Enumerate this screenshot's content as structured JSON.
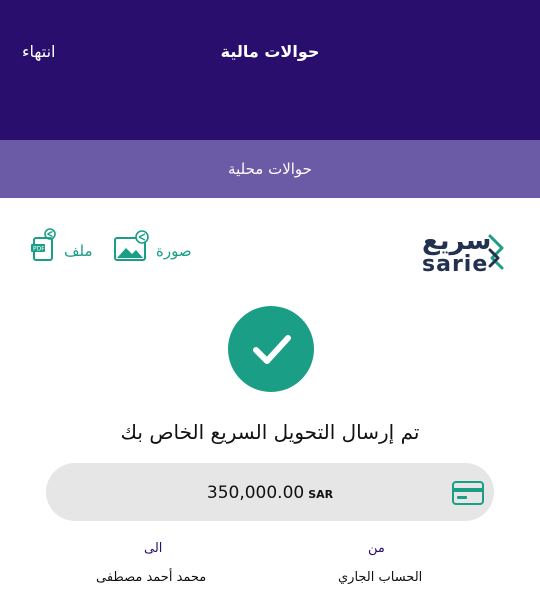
{
  "header": {
    "title": "حوالات مالية",
    "done_label": "انتهاء"
  },
  "subheader": {
    "title": "حوالات محلية"
  },
  "share": {
    "file_label": "ملف",
    "image_label": "صورة",
    "file_icon": "pdf-share-icon",
    "image_icon": "image-share-icon"
  },
  "brand": {
    "name_ar": "سريع",
    "name_en": "sarie",
    "color": "#22314f"
  },
  "status": {
    "icon": "check-icon",
    "message": "تم إرسال التحويل السريع الخاص بك"
  },
  "transfer": {
    "amount": "350,000.00",
    "currency": "SAR",
    "account_icon": "card-icon",
    "to_label": "الى",
    "from_label": "من",
    "to_value": "محمد أحمد مصطفى",
    "from_value": "الحساب الجاري"
  },
  "colors": {
    "header_bg": "#2a0e6e",
    "subheader_bg": "#6b5aa6",
    "accent": "#1a9e86",
    "amount_bg": "#e6e6e6"
  }
}
